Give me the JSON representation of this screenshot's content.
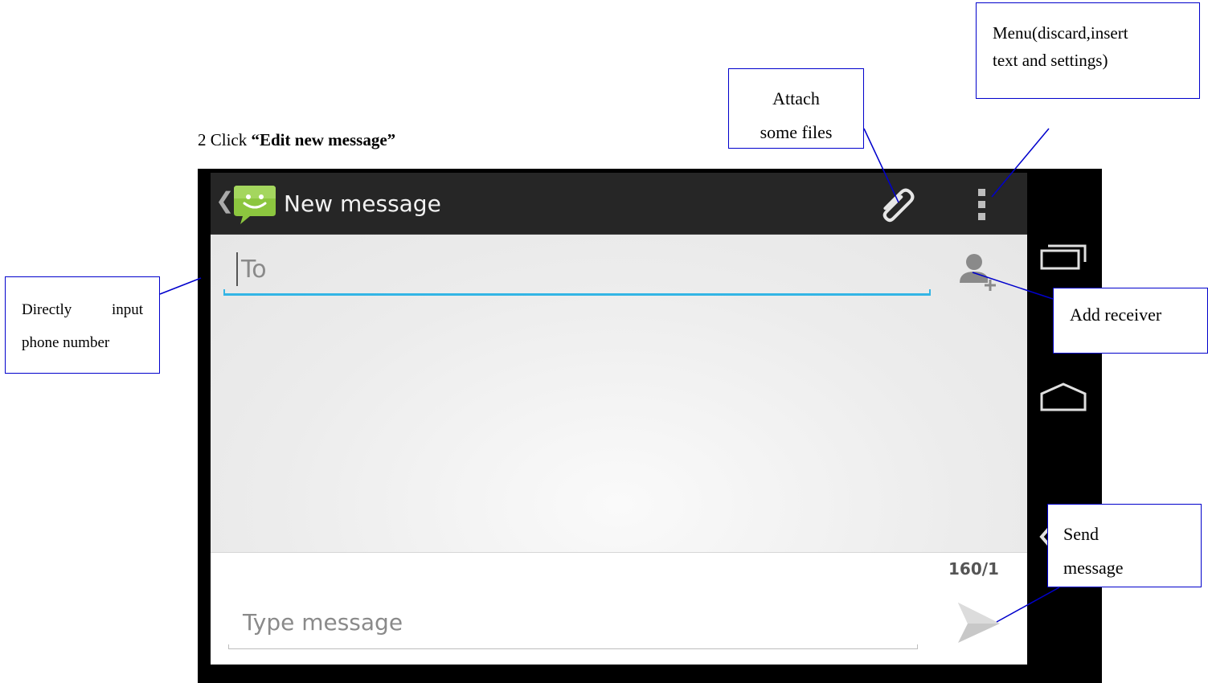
{
  "caption": {
    "prefix": "2 Click ",
    "emphasis": "“Edit new message”"
  },
  "actionbar": {
    "back_glyph": "❮",
    "title": "New message",
    "app_icon": "messaging-app-icon",
    "attach_icon": "paperclip-icon",
    "menu_icon": "overflow-menu-icon"
  },
  "recipient": {
    "placeholder": "To",
    "add_contact_icon": "add-person-icon"
  },
  "compose": {
    "counter": "160/1",
    "placeholder": "Type message",
    "send_icon": "send-icon"
  },
  "navbar": {
    "recents_icon": "recents-icon",
    "home_icon": "home-icon",
    "back_icon": "back-icon"
  },
  "callouts": {
    "menu_line1": "Menu(discard,insert",
    "menu_line2": "text and settings)",
    "attach_line1": "Attach",
    "attach_line2": "some files",
    "input_line1a": "Directly",
    "input_line1b": "input",
    "input_line2": "phone number",
    "receiver": "Add receiver",
    "send_line1": "Send",
    "send_line2": "message"
  },
  "colors": {
    "actionbar": "#262626",
    "accent_underline": "#33b5e5",
    "callout_border": "#0000cc",
    "app_icon_green": "#8cc63f"
  }
}
